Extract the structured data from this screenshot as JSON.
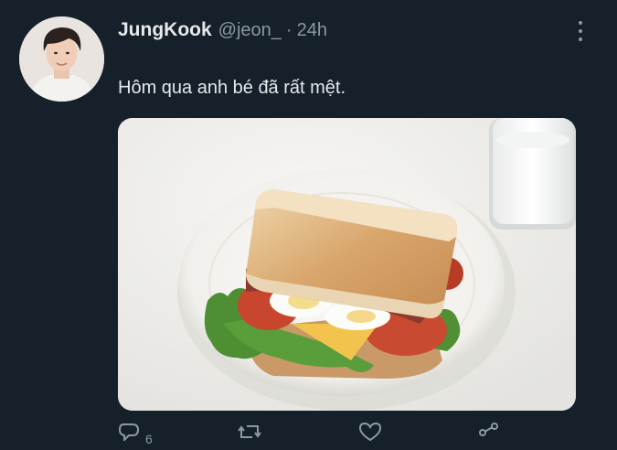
{
  "tweet": {
    "author": {
      "display_name": "JungKook",
      "handle": "@jeon_"
    },
    "separator": "·",
    "timestamp": "24h",
    "text": "Hôm qua anh bé đã rất mệt.",
    "media_description_icon": "photo-of-sandwich-on-plate",
    "actions": {
      "reply_count": "6"
    }
  },
  "colors": {
    "background": "#15202b",
    "primary_text": "#e7e9ea",
    "secondary_text": "#8b98a5"
  }
}
